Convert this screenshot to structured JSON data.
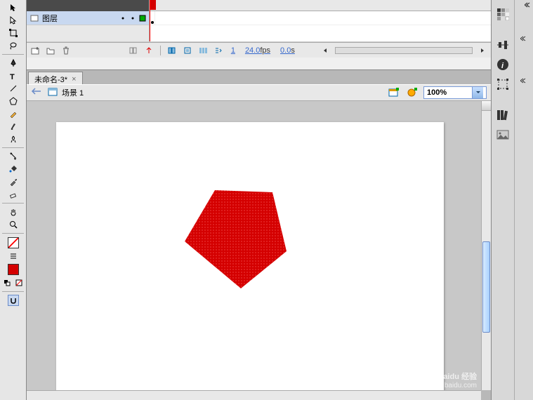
{
  "document": {
    "tab_title": "未命名-3*"
  },
  "breadcrumb": {
    "scene_label": "场景 1"
  },
  "timeline": {
    "layer_name": "图层",
    "current_frame": "1",
    "fps": "24.0",
    "fps_unit": "fps",
    "time": "0.0",
    "time_unit": "s"
  },
  "zoom": {
    "value": "100%"
  },
  "tools": {
    "arrow": "selection-tool-icon",
    "subselect": "subselection-tool-icon",
    "transform": "free-transform-icon",
    "lasso": "lasso-tool-icon",
    "pen": "pen-tool-icon",
    "text": "text-tool-icon",
    "line": "line-tool-icon",
    "rectangle": "rectangle-tool-icon",
    "pencil": "pencil-tool-icon",
    "brush": "brush-tool-icon",
    "deco": "deco-tool-icon",
    "bone": "bone-tool-icon",
    "paint_bucket": "paint-bucket-icon",
    "eyedropper": "eyedropper-tool-icon",
    "eraser": "eraser-tool-icon",
    "hand": "hand-tool-icon",
    "zoom_tool": "zoom-tool-icon"
  },
  "colors": {
    "stroke": "#ffffff",
    "fill": "#d40000",
    "shape_fill": "#d40000"
  },
  "panels": {
    "swatches": "swatches-icon",
    "align": "align-icon",
    "info": "info-icon",
    "transform": "transform-icon",
    "library": "library-icon",
    "color": "color-icon"
  },
  "watermark": {
    "brand": "Baidu 经验",
    "url": "jingyan.baidu.com"
  }
}
